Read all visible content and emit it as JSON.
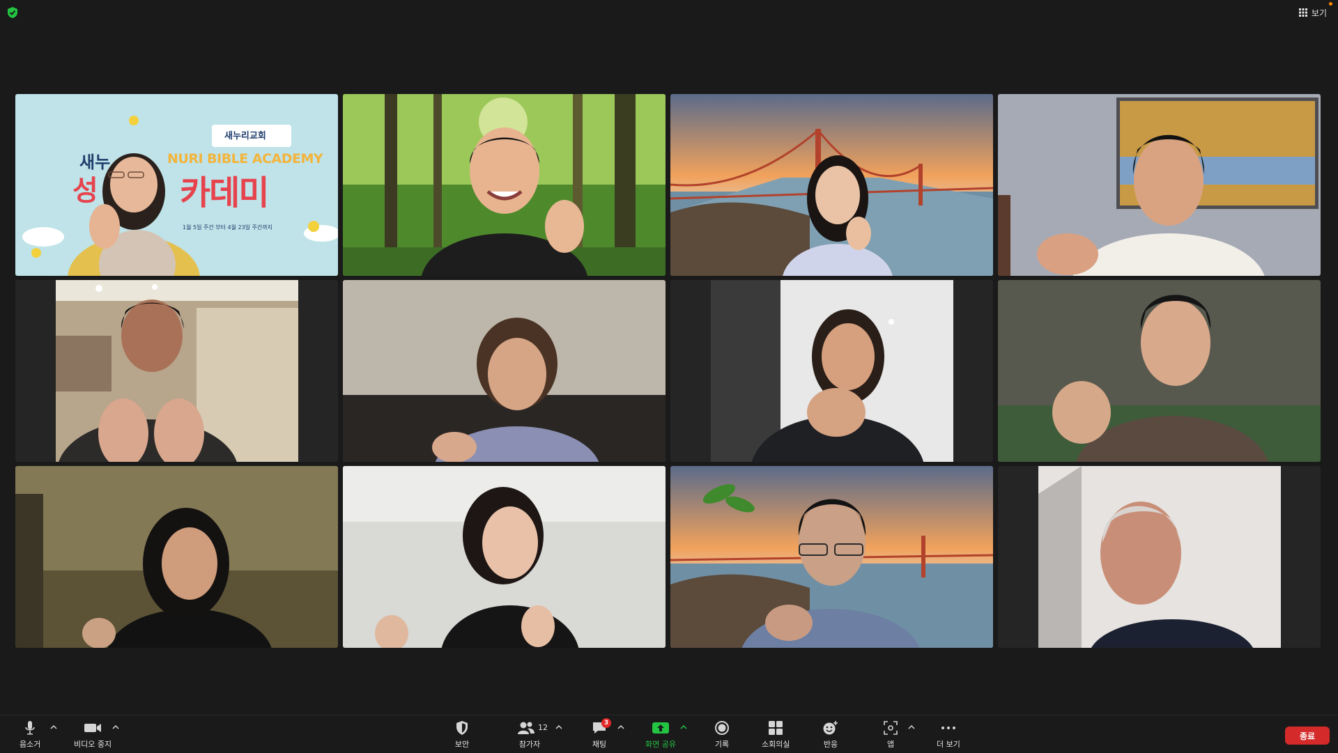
{
  "top": {
    "view_label": "보기"
  },
  "participants_count": "12",
  "tiles": [
    {
      "id": "t1",
      "banner": {
        "line1": "새누",
        "line1b": "NURI BIBLE ACADEMY",
        "line2a": "성",
        "line2b": "카데미",
        "dates": "1월 5일 주간 부터 4월 23일 주간까지",
        "logo": "새누리교회"
      }
    },
    {
      "id": "t2",
      "active": true
    },
    {
      "id": "t3"
    },
    {
      "id": "t4"
    },
    {
      "id": "t5"
    },
    {
      "id": "t6"
    },
    {
      "id": "t7"
    },
    {
      "id": "t8"
    },
    {
      "id": "t9"
    },
    {
      "id": "t10"
    },
    {
      "id": "t11"
    },
    {
      "id": "t12"
    }
  ],
  "toolbar": {
    "mute_label": "음소거",
    "video_label": "비디오 중지",
    "security_label": "보안",
    "participants_label": "참가자",
    "chat_label": "채팅",
    "chat_badge": "3",
    "share_label": "화면 공유",
    "record_label": "기록",
    "breakout_label": "소회의실",
    "reactions_label": "반응",
    "apps_label": "앱",
    "more_label": "더 보기",
    "end_label": "종료"
  },
  "colors": {
    "accent_green": "#24c443",
    "end_red": "#d42a2a",
    "chat_badge": "#e02828",
    "bg": "#1a1a1a"
  }
}
